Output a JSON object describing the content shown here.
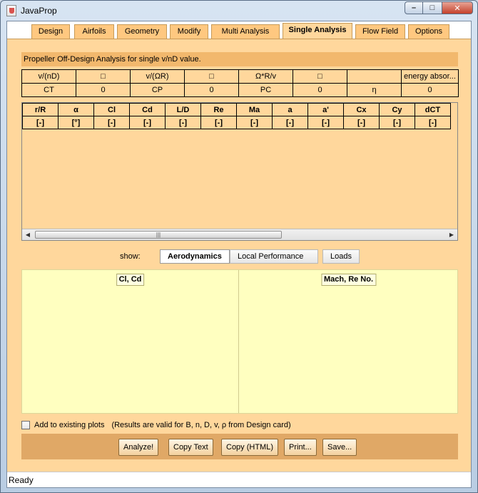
{
  "window": {
    "title": "JavaProp",
    "controls": {
      "minimize": "–",
      "maximize": "□",
      "close": "✕"
    }
  },
  "tabs": [
    {
      "label": "Design"
    },
    {
      "label": "Airfoils"
    },
    {
      "label": "Geometry"
    },
    {
      "label": "Modify"
    },
    {
      "label": "Multi Analysis"
    },
    {
      "label": "Single Analysis"
    },
    {
      "label": "Flow Field"
    },
    {
      "label": "Options"
    }
  ],
  "active_tab": "Single Analysis",
  "panel": {
    "heading": "Propeller Off-Design Analysis for single v/nD value.",
    "param_rows": [
      [
        "v/(nD)",
        "□",
        "v/(ΩR)",
        "□",
        "Ω*R/v",
        "□",
        "",
        "energy absor..."
      ],
      [
        "CT",
        "0",
        "CP",
        "0",
        "PC",
        "0",
        "η",
        "0"
      ]
    ],
    "results_headers": [
      "r/R",
      "α",
      "Cl",
      "Cd",
      "L/D",
      "Re",
      "Ma",
      "a",
      "a'",
      "Cx",
      "Cy",
      "dCT"
    ],
    "results_units": [
      "[-]",
      "[°]",
      "[-]",
      "[-]",
      "[-]",
      "[-]",
      "[-]",
      "[-]",
      "[-]",
      "[-]",
      "[-]",
      "[-]"
    ],
    "scrollbar": {
      "left": "◀",
      "right": "▶",
      "grip": "|||"
    },
    "show_label": "show:",
    "subtabs": [
      {
        "label": "Aerodynamics",
        "active": true
      },
      {
        "label": "Local Performance",
        "active": false
      },
      {
        "label": "Loads",
        "active": false
      }
    ],
    "plots": {
      "left_title": "Cl, Cd",
      "right_title": "Mach, Re No."
    },
    "add_to_existing_label": "Add to existing plots",
    "add_to_existing_checked": false,
    "validity_note": "(Results are valid for B, n, D, v, ρ  from Design card)",
    "buttons": {
      "analyze": "Analyze!",
      "copy_text": "Copy Text",
      "copy_html": "Copy (HTML)",
      "print": "Print...",
      "save": "Save..."
    }
  },
  "status": "Ready",
  "colors": {
    "tab_orange": "#ffc880",
    "panel_orange": "#ffd79c",
    "plot_yellow": "#ffffc0",
    "button_bar": "#e0a866"
  }
}
